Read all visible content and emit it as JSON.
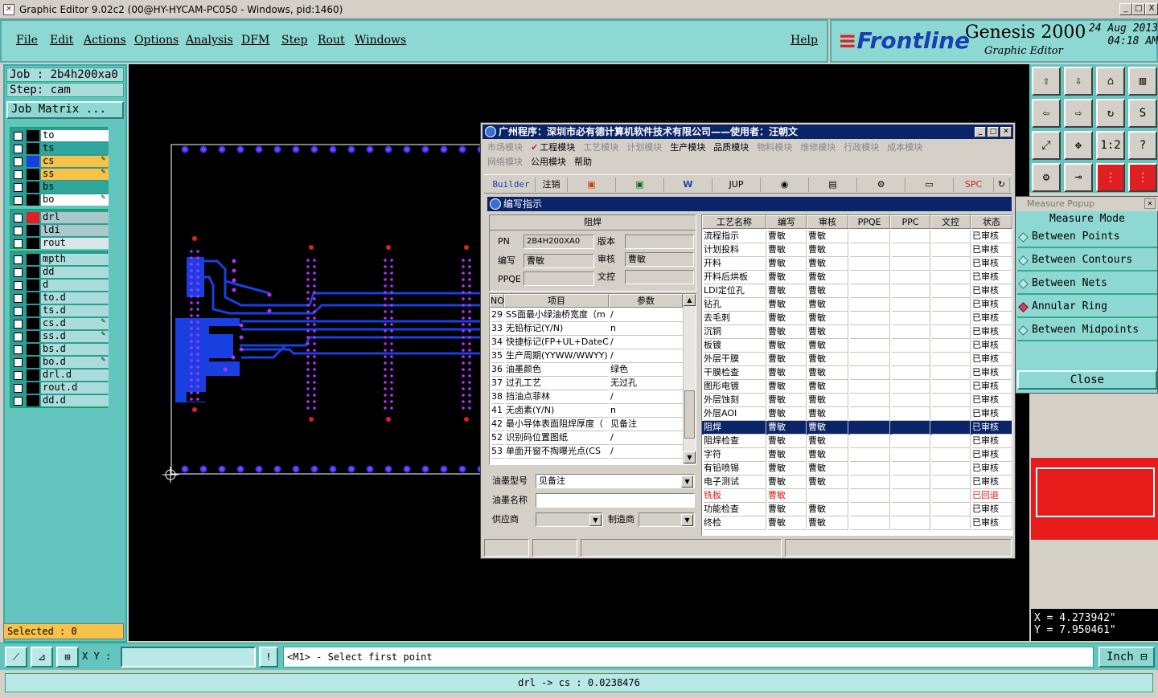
{
  "window": {
    "title": "Graphic Editor 9.02c2 (00@HY-HYCAM-PC050 - Windows, pid:1460)",
    "buttons": [
      "_",
      "□",
      "X"
    ]
  },
  "menu": {
    "items": [
      "File",
      "Edit",
      "Actions",
      "Options",
      "Analysis",
      "DFM",
      "Step",
      "Rout",
      "Windows"
    ],
    "help": "Help"
  },
  "brand": {
    "logo": "Frontline",
    "product": "Genesis 2000",
    "subtitle": "Graphic Editor",
    "date": "24 Aug 2013",
    "time": "04:18 AM"
  },
  "job": {
    "job_label": "Job : 2b4h200xa0",
    "step_label": "Step: cam",
    "matrix_button": "Job Matrix ..."
  },
  "layers": {
    "group1": [
      {
        "name": "to",
        "swatch": "#000000",
        "bg": "#ffffff",
        "editable": false
      },
      {
        "name": "ts",
        "swatch": "#000000",
        "bg": "#2fa79c",
        "editable": false
      },
      {
        "name": "cs",
        "swatch": "#1a3fe0",
        "bg": "#f7c24a",
        "editable": true
      },
      {
        "name": "ss",
        "swatch": "#000000",
        "bg": "#f7c24a",
        "editable": true
      },
      {
        "name": "bs",
        "swatch": "#000000",
        "bg": "#2fa79c",
        "editable": false
      },
      {
        "name": "bo",
        "swatch": "#000000",
        "bg": "#ffffff",
        "editable": true
      }
    ],
    "group2": [
      {
        "name": "drl",
        "swatch": "#e02020",
        "bg": "#a9c8cc",
        "editable": false
      },
      {
        "name": "ldi",
        "swatch": "#000000",
        "bg": "#a9c8cc",
        "editable": false
      },
      {
        "name": "rout",
        "swatch": "#000000",
        "bg": "#d8e8e8",
        "editable": false
      }
    ],
    "group3": [
      {
        "name": "mpth",
        "swatch": "#000000",
        "bg": "#a9dcda",
        "editable": false
      },
      {
        "name": "dd",
        "swatch": "#000000",
        "bg": "#a9dcda",
        "editable": false
      },
      {
        "name": "d",
        "swatch": "#000000",
        "bg": "#a9dcda",
        "editable": false
      },
      {
        "name": "to.d",
        "swatch": "#000000",
        "bg": "#a9dcda",
        "editable": false
      },
      {
        "name": "ts.d",
        "swatch": "#000000",
        "bg": "#a9dcda",
        "editable": false
      },
      {
        "name": "cs.d",
        "swatch": "#000000",
        "bg": "#a9dcda",
        "editable": true
      },
      {
        "name": "ss.d",
        "swatch": "#000000",
        "bg": "#a9dcda",
        "editable": true
      },
      {
        "name": "bs.d",
        "swatch": "#000000",
        "bg": "#a9dcda",
        "editable": false
      },
      {
        "name": "bo.d",
        "swatch": "#000000",
        "bg": "#a9dcda",
        "editable": true
      },
      {
        "name": "drl.d",
        "swatch": "#000000",
        "bg": "#a9dcda",
        "editable": false
      },
      {
        "name": "rout.d",
        "swatch": "#000000",
        "bg": "#a9dcda",
        "editable": false
      },
      {
        "name": "dd.d",
        "swatch": "#000000",
        "bg": "#a9dcda",
        "editable": false
      }
    ],
    "selected": "Selected : 0"
  },
  "measure": {
    "title": "Measure Popup",
    "mode_label": "Measure Mode",
    "options": [
      {
        "label": "Between Points",
        "active": false
      },
      {
        "label": "Between Contours",
        "active": false
      },
      {
        "label": "Between Nets",
        "active": false
      },
      {
        "label": "Annular Ring",
        "active": true
      },
      {
        "label": "Between Midpoints",
        "active": false
      }
    ],
    "close": "Close"
  },
  "coords": {
    "x": "X = 4.273942\"",
    "y": "Y = 7.950461\""
  },
  "cmdbar": {
    "xy_label": "X Y :",
    "prompt": "<M1> - Select first point",
    "units": "Inch"
  },
  "status": "drl -> cs : 0.0238476",
  "dialog": {
    "title": "广州程序：深圳市必有德计算机软件技术有限公司——使用者：汪朝文",
    "modules_row1": [
      {
        "label": "市场模块",
        "active": false
      },
      {
        "label": "工程模块",
        "active": true,
        "checked": true
      },
      {
        "label": "工艺模块",
        "active": false
      },
      {
        "label": "计划模块",
        "active": false
      },
      {
        "label": "生产模块",
        "active": true
      },
      {
        "label": "品质模块",
        "active": true
      },
      {
        "label": "物料模块",
        "active": false
      },
      {
        "label": "维修模块",
        "active": false
      },
      {
        "label": "行政模块",
        "active": false
      },
      {
        "label": "成本模块",
        "active": false
      }
    ],
    "modules_row2": [
      {
        "label": "网络模块",
        "active": false
      },
      {
        "label": "公用模块",
        "active": true
      },
      {
        "label": "帮助",
        "active": true
      }
    ],
    "toolbar": [
      "Builder",
      "注销",
      "",
      "",
      "W",
      "JUP",
      "",
      "",
      "",
      "",
      "SPC",
      ""
    ],
    "subtitle": "编写指示",
    "section": "阻焊",
    "form": {
      "pn_label": "PN",
      "pn_value": "2B4H200XA0",
      "ver_label": "版本",
      "ver_value": "",
      "write_label": "编写",
      "write_value": "曹敏",
      "audit_label": "审核",
      "audit_value": "曹敏",
      "ppqe_label": "PPQE",
      "ppqe_value": "",
      "doc_label": "文控",
      "doc_value": ""
    },
    "param_headers": [
      "NO",
      "项目",
      "参数"
    ],
    "params": [
      [
        "29",
        "SS面最小绿油桥宽度（m",
        "/"
      ],
      [
        "33",
        "无铅标记(Y/N)",
        "n"
      ],
      [
        "34",
        "快捷标记(FP+UL+DateCo",
        "/"
      ],
      [
        "35",
        "生产周期(YYWW/WWYY)",
        "/"
      ],
      [
        "36",
        "油墨颜色",
        "绿色"
      ],
      [
        "37",
        "过孔工艺",
        "无过孔"
      ],
      [
        "38",
        "挡油点菲林",
        "/"
      ],
      [
        "41",
        "无卤素(Y/N)",
        "n"
      ],
      [
        "42",
        "最小导体表面阻焊厚度（",
        "见备注"
      ],
      [
        "52",
        "识别码位置图纸",
        "/"
      ],
      [
        "53",
        "单面开窗不掏曝光点(CS",
        "/"
      ]
    ],
    "ink_type_label": "油墨型号",
    "ink_type_value": "见备注",
    "ink_name_label": "油墨名称",
    "ink_name_value": "",
    "supplier_label": "供应商",
    "supplier_value": "",
    "maker_label": "制造商",
    "maker_value": "",
    "proc_headers": [
      "工艺名称",
      "编写",
      "审核",
      "PPQE",
      "PPC",
      "文控",
      "状态"
    ],
    "procs": [
      [
        "流程指示",
        "曹敏",
        "曹敏",
        "",
        "",
        "",
        "已审核"
      ],
      [
        "计划投料",
        "曹敏",
        "曹敏",
        "",
        "",
        "",
        "已审核"
      ],
      [
        "开料",
        "曹敏",
        "曹敏",
        "",
        "",
        "",
        "已审核"
      ],
      [
        "开料后烘板",
        "曹敏",
        "曹敏",
        "",
        "",
        "",
        "已审核"
      ],
      [
        "LDI定位孔",
        "曹敏",
        "曹敏",
        "",
        "",
        "",
        "已审核"
      ],
      [
        "钻孔",
        "曹敏",
        "曹敏",
        "",
        "",
        "",
        "已审核"
      ],
      [
        "去毛刺",
        "曹敏",
        "曹敏",
        "",
        "",
        "",
        "已审核"
      ],
      [
        "沉铜",
        "曹敏",
        "曹敏",
        "",
        "",
        "",
        "已审核"
      ],
      [
        "板镀",
        "曹敏",
        "曹敏",
        "",
        "",
        "",
        "已审核"
      ],
      [
        "外层干膜",
        "曹敏",
        "曹敏",
        "",
        "",
        "",
        "已审核"
      ],
      [
        "干膜检查",
        "曹敏",
        "曹敏",
        "",
        "",
        "",
        "已审核"
      ],
      [
        "图形电镀",
        "曹敏",
        "曹敏",
        "",
        "",
        "",
        "已审核"
      ],
      [
        "外层蚀刻",
        "曹敏",
        "曹敏",
        "",
        "",
        "",
        "已审核"
      ],
      [
        "外层AOI",
        "曹敏",
        "曹敏",
        "",
        "",
        "",
        "已审核"
      ],
      [
        "阻焊",
        "曹敏",
        "曹敏",
        "",
        "",
        "",
        "已审核"
      ],
      [
        "阻焊检查",
        "曹敏",
        "曹敏",
        "",
        "",
        "",
        "已审核"
      ],
      [
        "字符",
        "曹敏",
        "曹敏",
        "",
        "",
        "",
        "已审核"
      ],
      [
        "有铅喷锡",
        "曹敏",
        "曹敏",
        "",
        "",
        "",
        "已审核"
      ],
      [
        "电子测试",
        "曹敏",
        "曹敏",
        "",
        "",
        "",
        "已审核"
      ],
      [
        "铣板",
        "曹敏",
        "",
        "",
        "",
        "",
        "已回退"
      ],
      [
        "功能检查",
        "曹敏",
        "曹敏",
        "",
        "",
        "",
        "已审核"
      ],
      [
        "终检",
        "曹敏",
        "曹敏",
        "",
        "",
        "",
        "已审核"
      ]
    ],
    "selected_proc": "阻焊",
    "returned_proc": "铣板"
  },
  "colors": {
    "accent_teal": "#8ed8d4",
    "dialog_blue": "#0a246a",
    "pcb_blue": "#1a3fe0",
    "pad_magenta": "#b030ff",
    "drill_red": "#e02020"
  }
}
